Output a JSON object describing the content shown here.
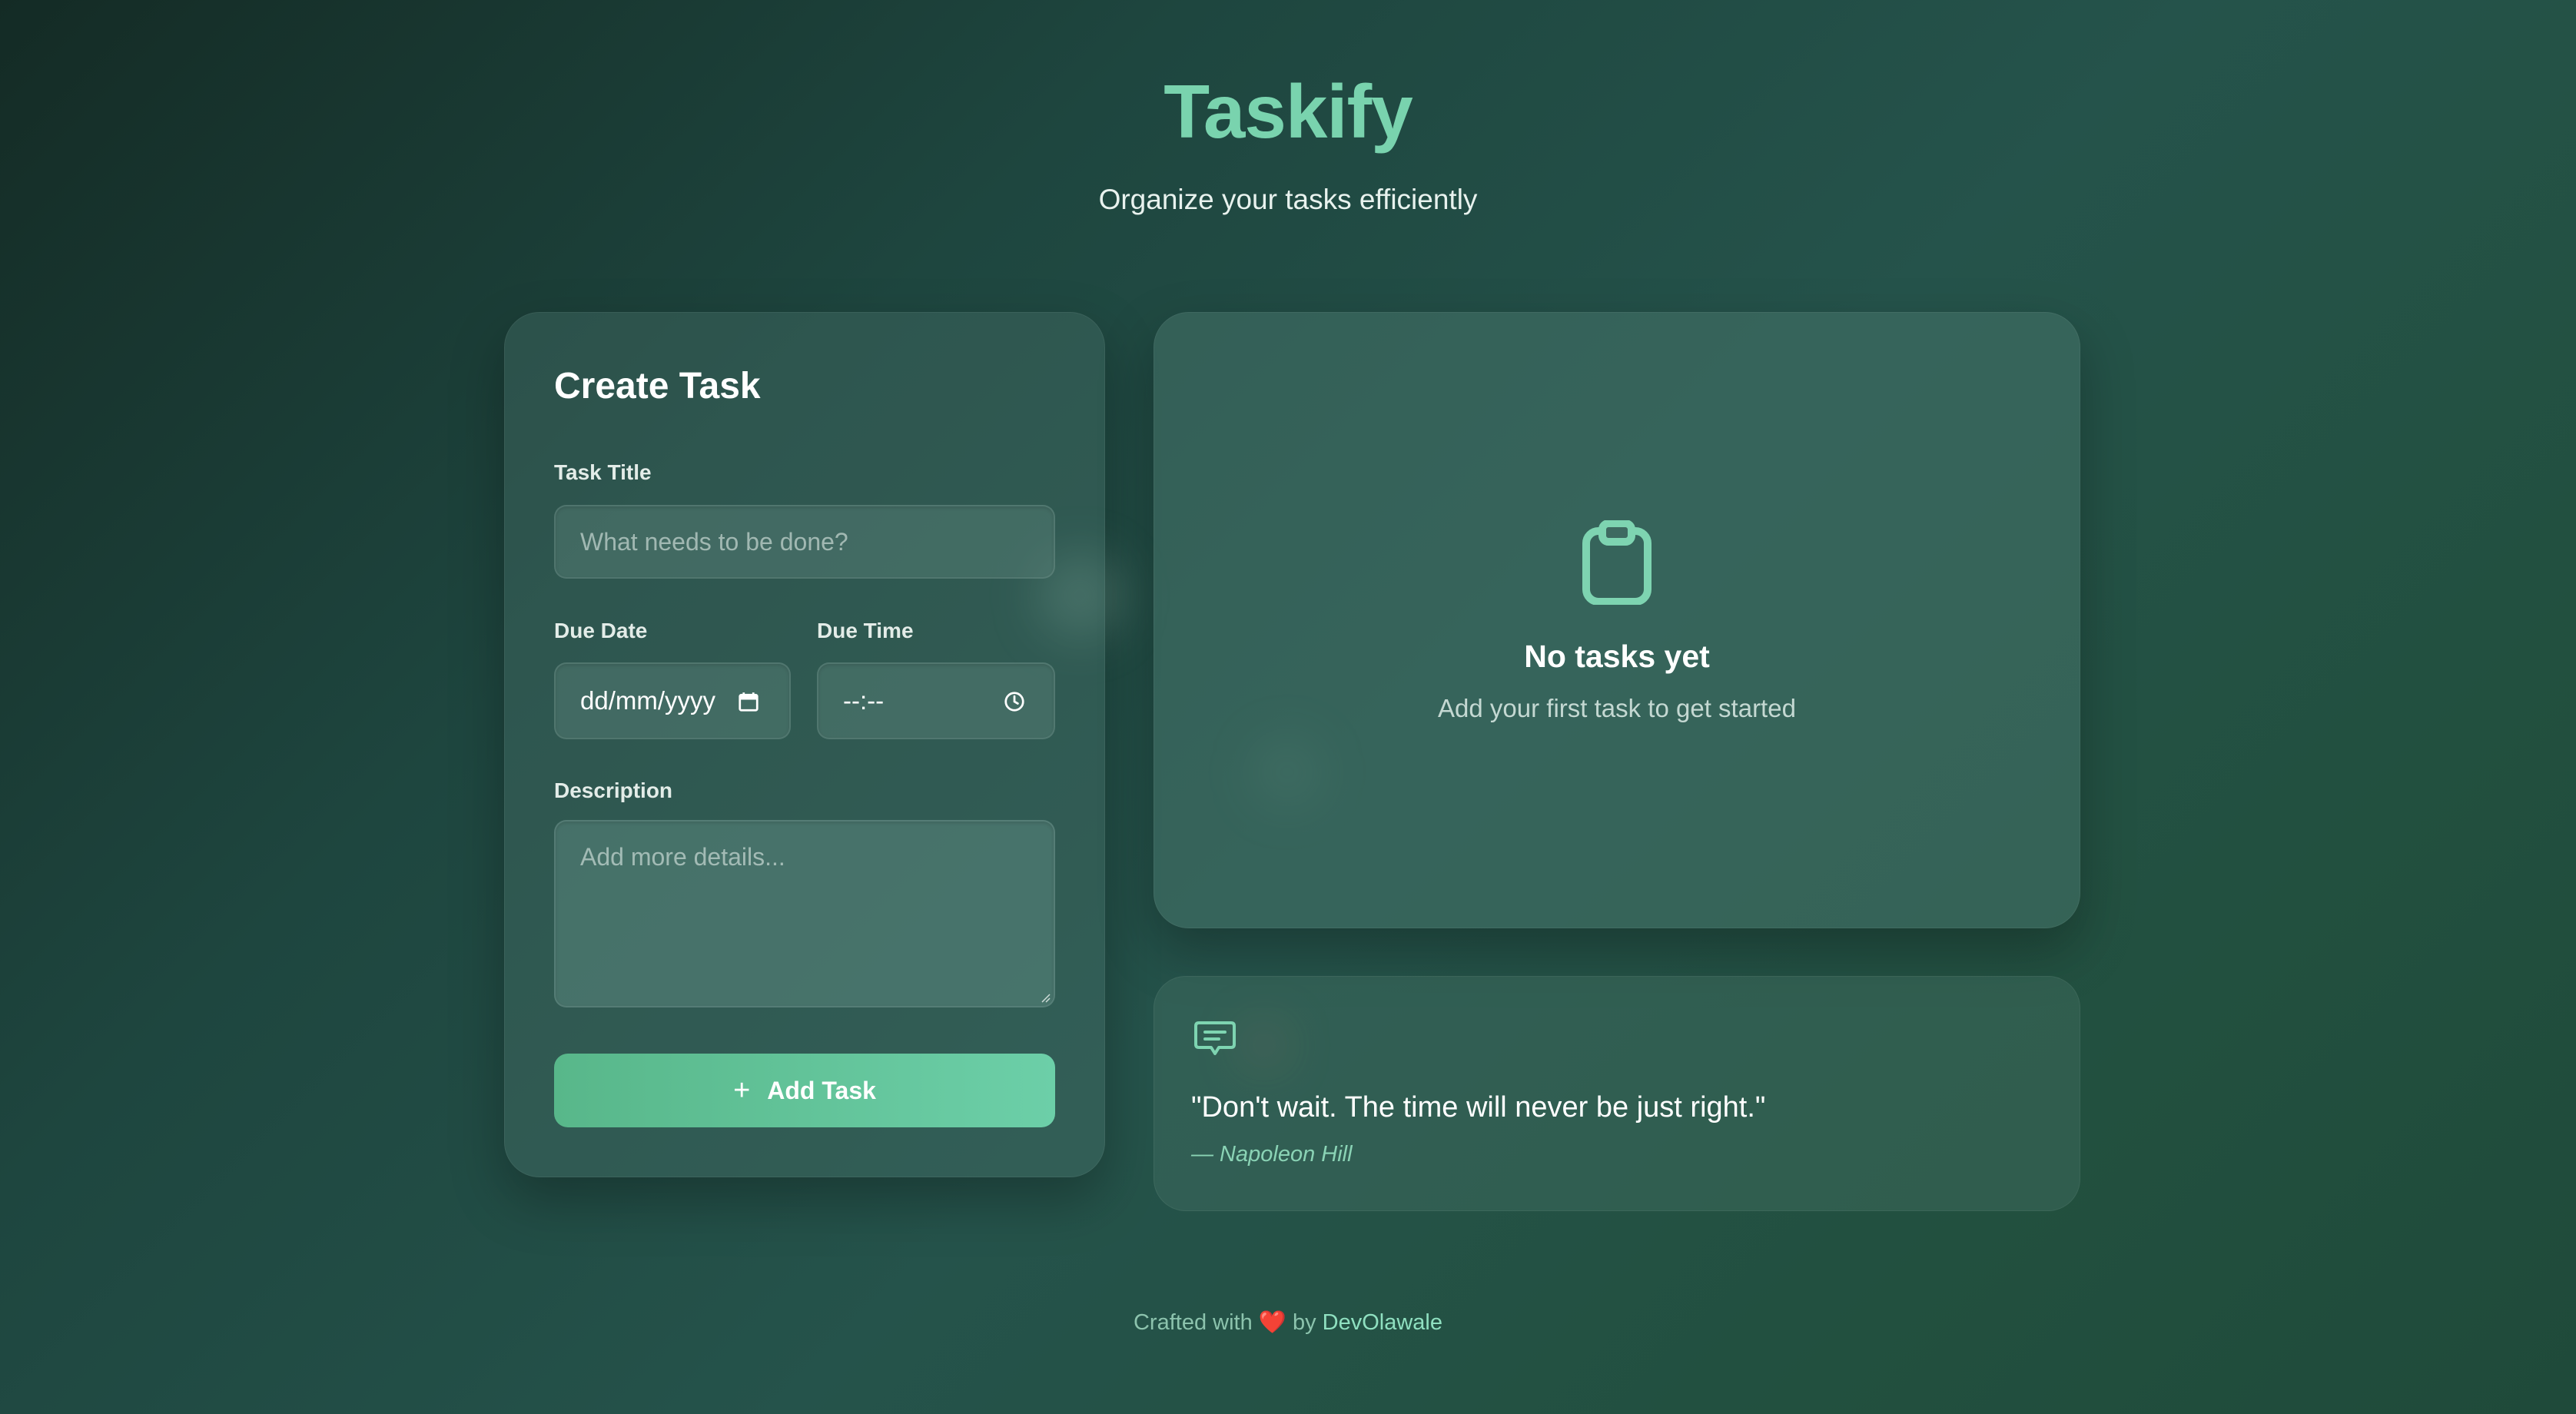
{
  "header": {
    "title": "Taskify",
    "subtitle": "Organize your tasks efficiently"
  },
  "create_task": {
    "heading": "Create Task",
    "task_title_label": "Task Title",
    "task_title_placeholder": "What needs to be done?",
    "due_date_label": "Due Date",
    "due_date_value": "dd/mm/yyyy",
    "due_date_icon": "calendar-icon",
    "due_time_label": "Due Time",
    "due_time_value": "--:--",
    "due_time_icon": "clock-icon",
    "description_label": "Description",
    "description_placeholder": "Add more details...",
    "add_button_icon": "+",
    "add_button_label": "Add Task"
  },
  "task_list": {
    "empty_icon": "clipboard-icon",
    "empty_title": "No tasks yet",
    "empty_subtitle": "Add your first task to get started"
  },
  "quote": {
    "icon": "message-icon",
    "text": "\"Don't wait. The time will never be just right.\"",
    "author": "— Napoleon Hill"
  },
  "footer": {
    "prefix": "Crafted with",
    "heart": "❤️",
    "by": "by",
    "author": "DevOlawale"
  },
  "colors": {
    "accent": "#79d3ae",
    "button_start": "#58b78a",
    "button_end": "#6ccfa8",
    "heart": "#e0453e"
  }
}
